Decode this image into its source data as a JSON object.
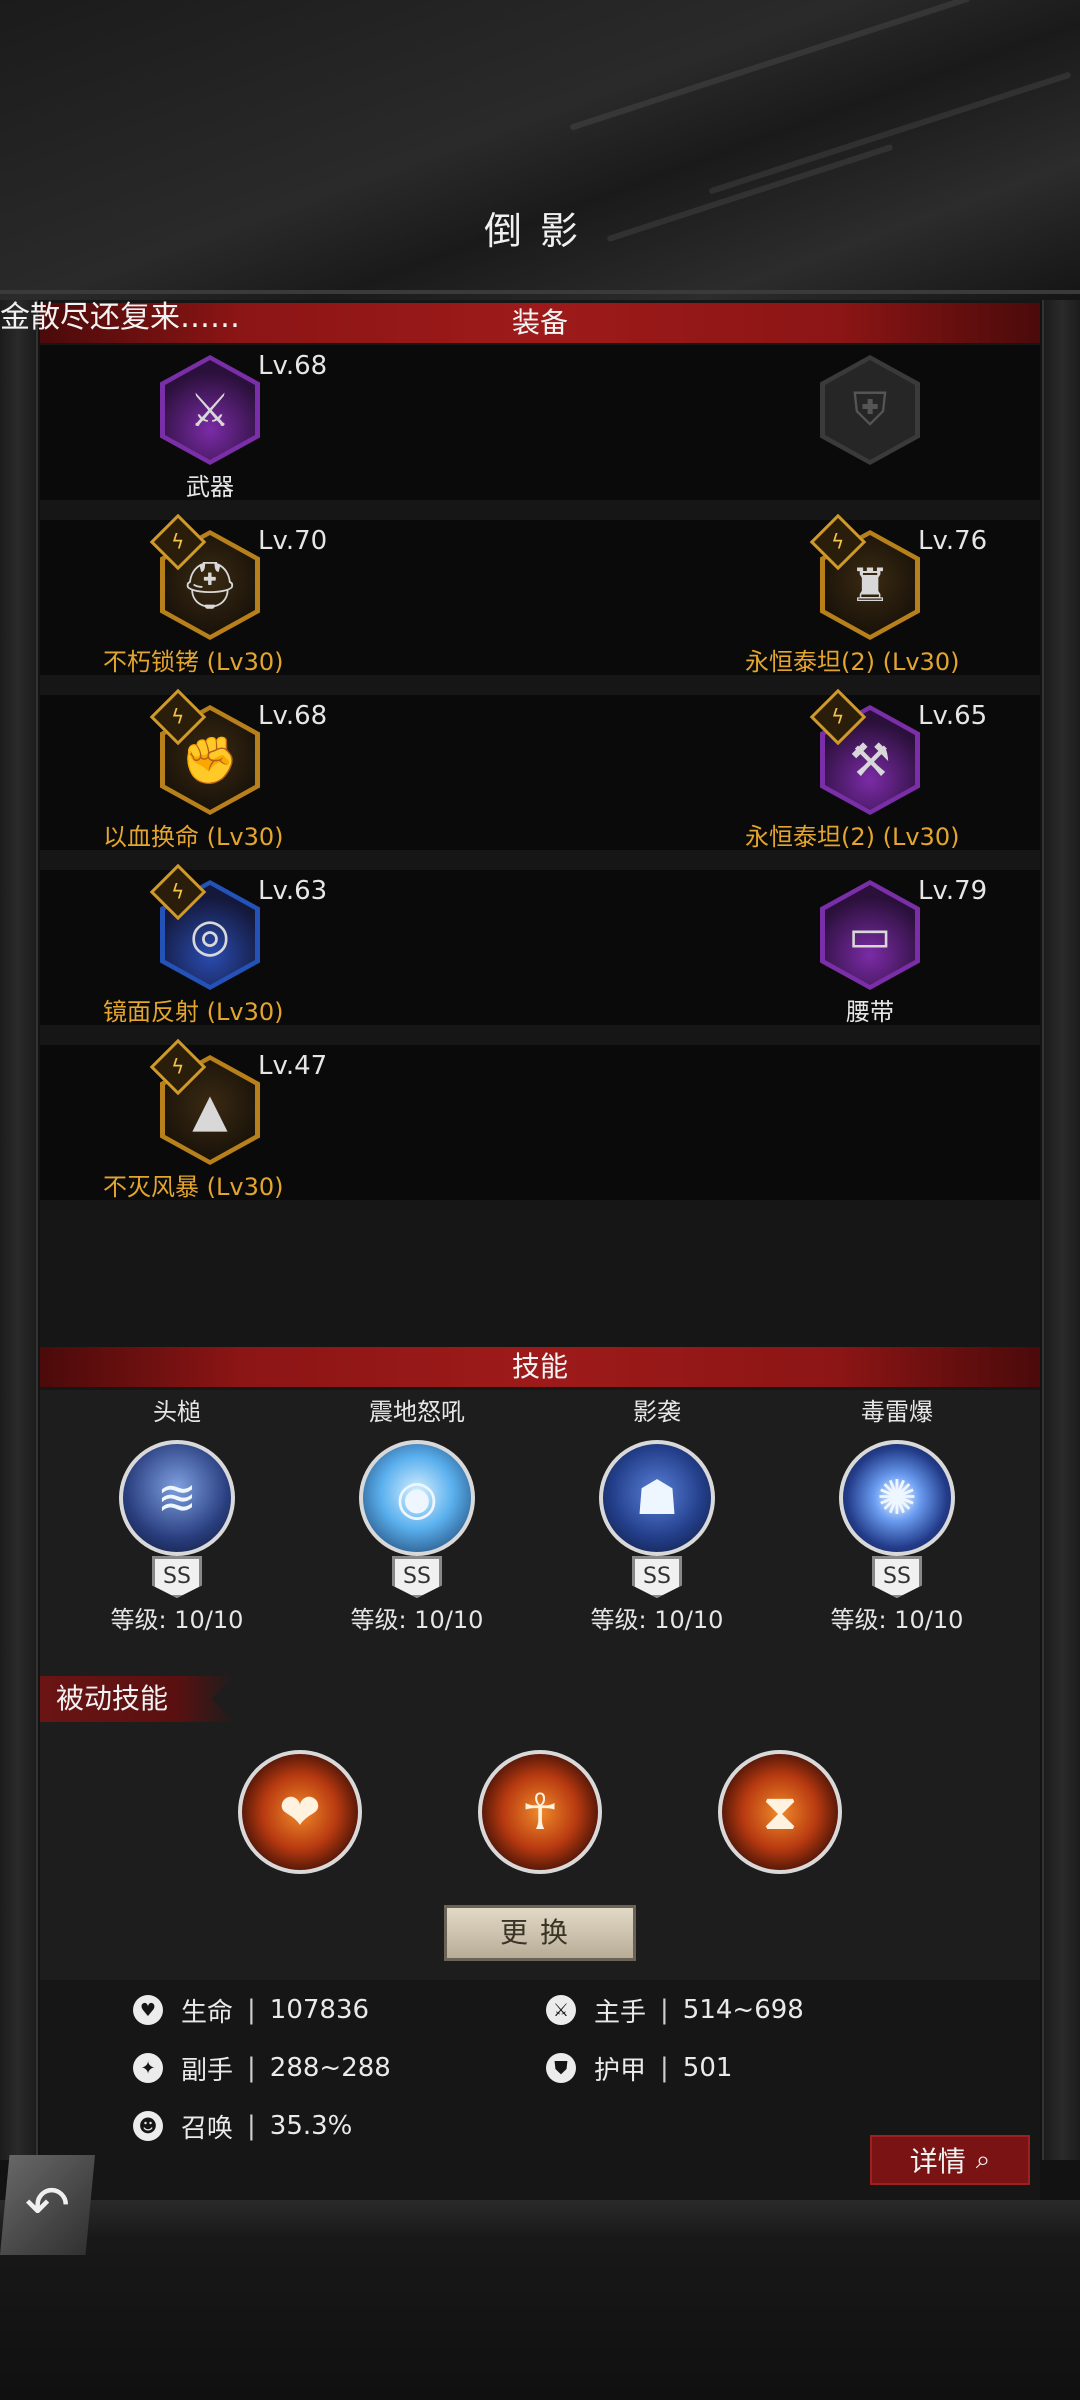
{
  "header": {
    "title": "倒影",
    "marquee": "金散尽还复来……"
  },
  "sections": {
    "equipment": "装备",
    "skills": "技能",
    "passive": "被动技能"
  },
  "equipment": [
    {
      "icon": "axe-weapon-icon",
      "level": "Lv.68",
      "label": "武器",
      "rarity": "purple",
      "badge": false
    },
    {
      "icon": "shield-slot-icon",
      "level": "",
      "label": "",
      "rarity": "empty",
      "badge": false
    },
    {
      "icon": "helmet-icon",
      "level": "Lv.70",
      "label": "不朽锁铐  (Lv30)",
      "rarity": "gold",
      "badge": true
    },
    {
      "icon": "shoulder-armor-icon",
      "level": "Lv.76",
      "label": "永恒泰坦(2)  (Lv30)",
      "rarity": "gold",
      "badge": true
    },
    {
      "icon": "gauntlet-icon",
      "level": "Lv.68",
      "label": "以血换命  (Lv30)",
      "rarity": "gold",
      "badge": true
    },
    {
      "icon": "greaves-icon",
      "level": "Lv.65",
      "label": "永恒泰坦(2)  (Lv30)",
      "rarity": "purple",
      "badge": true
    },
    {
      "icon": "ring-icon",
      "level": "Lv.63",
      "label": "镜面反射  (Lv30)",
      "rarity": "blue",
      "badge": true
    },
    {
      "icon": "belt-icon",
      "level": "Lv.79",
      "label": "腰带",
      "rarity": "purple",
      "badge": false
    },
    {
      "icon": "cloak-icon",
      "level": "Lv.47",
      "label": "不灭风暴  (Lv30)",
      "rarity": "gold",
      "badge": true
    }
  ],
  "skills": [
    {
      "name": "头槌",
      "rank": "SS",
      "level": "等级: 10/10",
      "icon": "headbutt-skill-icon"
    },
    {
      "name": "震地怒吼",
      "rank": "SS",
      "level": "等级: 10/10",
      "icon": "roar-skill-icon"
    },
    {
      "name": "影袭",
      "rank": "SS",
      "level": "等级: 10/10",
      "icon": "shadow-strike-skill-icon"
    },
    {
      "name": "毒雷爆",
      "rank": "SS",
      "level": "等级: 10/10",
      "icon": "poison-blast-skill-icon"
    }
  ],
  "passives": [
    {
      "icon": "heart-hands-passive-icon"
    },
    {
      "icon": "figure-aura-passive-icon"
    },
    {
      "icon": "hourglass-passive-icon"
    }
  ],
  "buttons": {
    "swap": "更换",
    "details": "详情"
  },
  "stats": [
    {
      "icon": "heart-icon",
      "label": "生命",
      "value": "107836"
    },
    {
      "icon": "sword-icon",
      "label": "主手",
      "value": "514~698"
    },
    {
      "icon": "offhand-icon",
      "label": "副手",
      "value": "288~288"
    },
    {
      "icon": "armor-icon",
      "label": "护甲",
      "value": "501"
    },
    {
      "icon": "summon-icon",
      "label": "召唤",
      "value": "35.3%"
    }
  ],
  "colors": {
    "gold": "#e3a52e",
    "red_bar": "#9e1a1a",
    "purple": "#7a2ea8",
    "blue": "#2452b8"
  }
}
